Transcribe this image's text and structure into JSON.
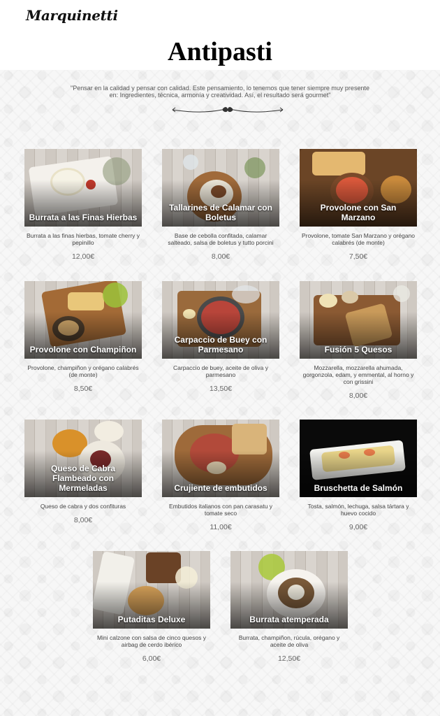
{
  "brand": {
    "logo_text": "Marquinetti"
  },
  "page": {
    "title": "Antipasti",
    "quote": "\"Pensar en la calidad y pensar con calidad. Este pensamiento, lo tenemos que tener siempre muy presente en: Ingredientes, técnica, armonía y creatividad. Así, el resultado será gourmet\""
  },
  "dishes": [
    {
      "name": "Burrata a las Finas Hierbas",
      "description": "Burrata a las finas hierbas, tomate cherry y pepinillo",
      "price": "12,00€"
    },
    {
      "name": "Tallarines de Calamar con Boletus",
      "description": "Base de cebolla confitada, calamar salteado, salsa de boletus y tutto porcini",
      "price": "8,00€"
    },
    {
      "name": "Provolone con San Marzano",
      "description": "Provolone, tomate San Marzano y orégano calabrés (de monte)",
      "price": "7,50€"
    },
    {
      "name": "Provolone con Champiñon",
      "description": "Provolone, champiñon y orégano calabrés (de monte)",
      "price": "8,50€"
    },
    {
      "name": "Carpaccio de Buey con Parmesano",
      "description": "Carpaccio de buey, aceite de oliva y parmesano",
      "price": "13,50€"
    },
    {
      "name": "Fusión 5 Quesos",
      "description": "Mozzarella, mozzarella ahumada, gorgonzola, edam, y emmental, al horno y con grissini",
      "price": "8,00€"
    },
    {
      "name": "Queso de Cabra Flambeado con Mermeladas",
      "description": "Queso de cabra y dos confituras",
      "price": "8,00€"
    },
    {
      "name": "Crujiente de embutidos",
      "description": "Embutidos italianos con pan carasatu y tomate seco",
      "price": "11,00€"
    },
    {
      "name": "Bruschetta de Salmón",
      "description": "Tosta, salmón, lechuga, salsa tártara y huevo cocido",
      "price": "9,00€"
    },
    {
      "name": "Putaditas Deluxe",
      "description": "Mini calzone con salsa de cinco quesos y airbag de cerdo ibérico",
      "price": "6,00€"
    },
    {
      "name": "Burrata atemperada",
      "description": "Burrata, champiñon, rúcula, orégano y aceite de oliva",
      "price": "12,50€"
    }
  ]
}
